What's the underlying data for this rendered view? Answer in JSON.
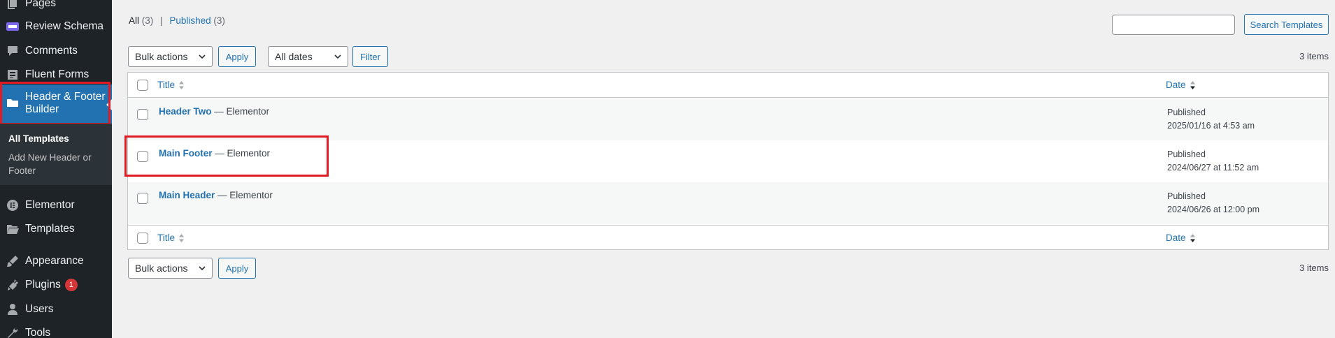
{
  "sidebar": {
    "items": [
      {
        "label": "Pages",
        "icon": "pages-icon"
      },
      {
        "label": "Review Schema",
        "icon": "review-schema-icon"
      },
      {
        "label": "Comments",
        "icon": "comments-icon"
      },
      {
        "label": "Fluent Forms",
        "icon": "fluent-forms-icon"
      },
      {
        "label": "Header & Footer Builder",
        "icon": "folder-icon"
      },
      {
        "label": "Elementor",
        "icon": "elementor-icon"
      },
      {
        "label": "Templates",
        "icon": "folder-open-icon"
      },
      {
        "label": "Appearance",
        "icon": "paintbrush-icon"
      },
      {
        "label": "Plugins",
        "icon": "plugin-icon",
        "badge": "1"
      },
      {
        "label": "Users",
        "icon": "users-icon"
      },
      {
        "label": "Tools",
        "icon": "wrench-icon"
      }
    ],
    "submenu": [
      {
        "label": "All Templates"
      },
      {
        "label": "Add New Header or Footer"
      }
    ]
  },
  "filters": {
    "all_label": "All",
    "all_count": "(3)",
    "separator": "|",
    "published_label": "Published",
    "published_count": "(3)"
  },
  "search": {
    "value": "",
    "button_label": "Search Templates"
  },
  "tablenav_top": {
    "bulk_actions": "Bulk actions",
    "apply": "Apply",
    "dates": "All dates",
    "filter": "Filter",
    "count": "3 items"
  },
  "table": {
    "columns": {
      "title": "Title",
      "date": "Date"
    },
    "rows": [
      {
        "title": "Header Two",
        "suffix": "— Elementor",
        "status": "Published",
        "date": "2025/01/16 at 4:53 am"
      },
      {
        "title": "Main Footer",
        "suffix": "— Elementor",
        "status": "Published",
        "date": "2024/06/27 at 11:52 am"
      },
      {
        "title": "Main Header",
        "suffix": "— Elementor",
        "status": "Published",
        "date": "2024/06/26 at 12:00 pm"
      }
    ]
  },
  "tablenav_bottom": {
    "bulk_actions": "Bulk actions",
    "apply": "Apply",
    "count": "3 items"
  },
  "colors": {
    "sidebar_bg": "#1d2327",
    "active_menu": "#2271b1",
    "highlight_box": "#e01b24",
    "link": "#2271b1"
  }
}
